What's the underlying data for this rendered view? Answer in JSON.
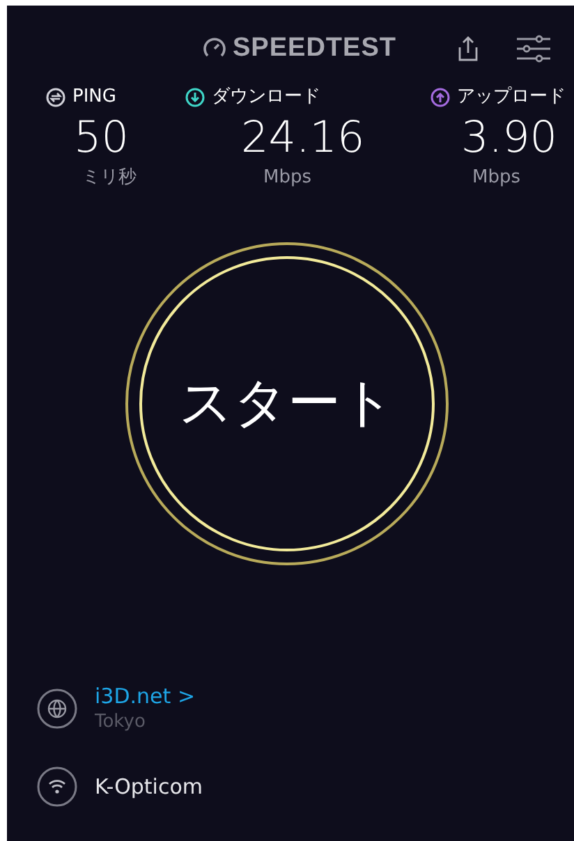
{
  "header": {
    "logo": "SPEEDTEST"
  },
  "metrics": [
    {
      "kind": "ping",
      "label": "PING",
      "value": "50",
      "unit": "ミリ秒",
      "color": "#d0d0d8"
    },
    {
      "kind": "download",
      "label": "ダウンロード",
      "value": "24.16",
      "unit": "Mbps",
      "color": "#3fd6c8"
    },
    {
      "kind": "upload",
      "label": "アップロード",
      "value": "3.90",
      "unit": "Mbps",
      "color": "#a46bdf"
    }
  ],
  "start_button": {
    "label": "スタート"
  },
  "server": {
    "name": "i3D.net",
    "chevron": ">",
    "location": "Tokyo"
  },
  "provider": {
    "name": "K-Opticom"
  }
}
